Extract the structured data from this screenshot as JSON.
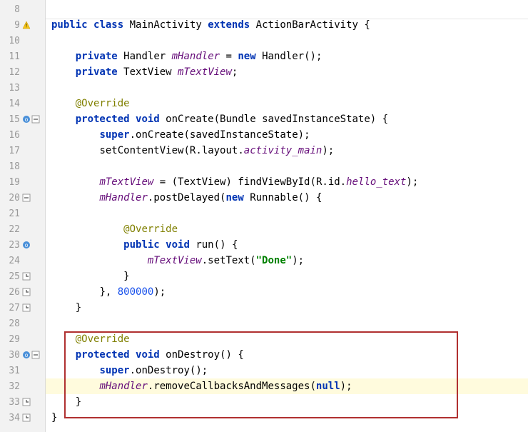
{
  "line_numbers": [
    "8",
    "9",
    "10",
    "11",
    "12",
    "13",
    "14",
    "15",
    "16",
    "17",
    "18",
    "19",
    "20",
    "21",
    "22",
    "23",
    "24",
    "25",
    "26",
    "27",
    "28",
    "29",
    "30",
    "31",
    "32",
    "33",
    "34"
  ],
  "gutter": {
    "9": [
      "warning"
    ],
    "15": [
      "override",
      "fold-open"
    ],
    "20": [
      "fold-open"
    ],
    "23": [
      "override"
    ],
    "25": [
      "fold-close"
    ],
    "26": [
      "fold-close"
    ],
    "27": [
      "fold-close"
    ],
    "30": [
      "override",
      "fold-open"
    ],
    "33": [
      "fold-close"
    ],
    "34": [
      "fold-close"
    ]
  },
  "tokens": {
    "public": "public",
    "class": "class",
    "MainActivity": "MainActivity",
    "extends": "extends",
    "ActionBarActivity": "ActionBarActivity",
    "lbrace": "{",
    "rbrace": "}",
    "private": "private",
    "Handler": "Handler",
    "mHandler": "mHandler",
    "eq": "=",
    "new": "new",
    "HandlerCtor": "Handler()",
    "semi": ";",
    "TextView": "TextView",
    "mTextView": "mTextView",
    "Override": "@Override",
    "protected": "protected",
    "void": "void",
    "onCreate": "onCreate",
    "lparen": "(",
    "rparen": ")",
    "Bundle": "Bundle",
    "savedInstanceState": "savedInstanceState",
    "super": "super",
    "dot": ".",
    "setContentView": "setContentView",
    "R": "R",
    "layout": "layout",
    "activity_main": "activity_main",
    "cast_TextView": "(TextView)",
    "findViewById": "findViewById",
    "id": "id",
    "hello_text": "hello_text",
    "postDelayed": "postDelayed",
    "Runnable": "Runnable",
    "run": "run",
    "setText": "setText",
    "done_str": "\"Done\"",
    "comma": ",",
    "delay": "800000",
    "onDestroy": "onDestroy",
    "removeCallbacksAndMessages": "removeCallbacksAndMessages",
    "null": "null"
  },
  "highlighted_line": "32",
  "highlight_box": {
    "startLine": "29",
    "endLine": "33"
  }
}
